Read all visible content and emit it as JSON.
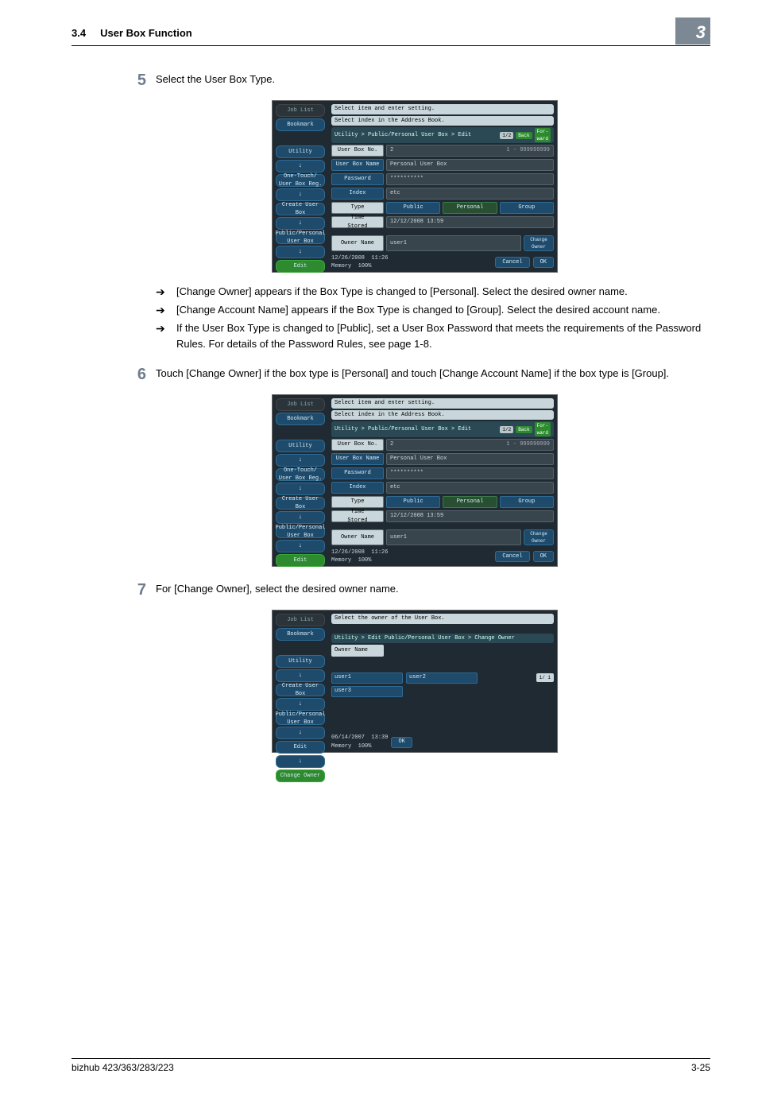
{
  "header": {
    "section_no": "3.4",
    "section_title": "User Box Function",
    "badge": "3"
  },
  "steps": {
    "s5": {
      "num": "5",
      "text": "Select the User Box Type."
    },
    "s6": {
      "num": "6",
      "text": "Touch [Change Owner] if the box type is [Personal] and touch [Change Account Name] if the box type is [Group]."
    },
    "s7": {
      "num": "7",
      "text": "For [Change Owner], select the desired owner name."
    }
  },
  "notes": {
    "n1": "[Change Owner] appears if the Box Type is changed to [Personal]. Select the desired owner name.",
    "n2": "[Change Account Name] appears if the Box Type is changed to [Group]. Select the desired account name.",
    "n3": "If the User Box Type is changed to [Public], set a User Box Password that meets the requirements of the Password Rules. For details of the Password Rules, see page 1-8."
  },
  "panelA": {
    "side": {
      "joblist": "Job List",
      "bookmark": "Bookmark",
      "utility": "Utility",
      "onetouch": "One-Touch/\nUser Box Reg.",
      "create": "Create User Box",
      "pp": "Public/Personal\nUser Box",
      "edit": "Edit"
    },
    "top1": "Select item and enter setting.",
    "top2": "Select index in the Address Book.",
    "crumb": "Utility > Public/Personal User  Box > Edit",
    "page": "1/2",
    "back": "Back",
    "fwd": "For-\nward",
    "labels": {
      "no": "User Box No.",
      "name": "User Box Name",
      "pw": "Password",
      "index": "Index",
      "type": "Type",
      "time": "Time\nStored"
    },
    "vals": {
      "no": "2",
      "range": "1 - 999999999",
      "name": "Personal User Box",
      "pw": "**********",
      "index": "etc",
      "time": "12/12/2008   13:59"
    },
    "types": {
      "public": "Public",
      "personal": "Personal",
      "group": "Group"
    },
    "owner": {
      "lbl": "Owner Name",
      "val": "user1",
      "chg": "Change\nOwner"
    },
    "footer": {
      "date": "12/26/2008",
      "time": "11:26",
      "mem": "Memory",
      "pct": "100%",
      "cancel": "Cancel",
      "ok": "OK"
    }
  },
  "panelC": {
    "side": {
      "joblist": "Job List",
      "bookmark": "Bookmark",
      "utility": "Utility",
      "create": "Create User Box",
      "pp": "Public/Personal\nUser Box",
      "edit": "Edit",
      "chg": "Change Owner"
    },
    "top1": "Select the owner of the User Box.",
    "crumb": "Utility > Edit Public/Personal User Box > Change Owner",
    "ownerlbl": "Owner Name",
    "users": {
      "u1": "user1",
      "u2": "user2",
      "u3": "user3"
    },
    "page": "1/  1",
    "footer": {
      "date": "06/14/2007",
      "time": "13:39",
      "mem": "Memory",
      "pct": "100%",
      "ok": "OK"
    }
  },
  "footer": {
    "model": "bizhub 423/363/283/223",
    "page": "3-25"
  }
}
